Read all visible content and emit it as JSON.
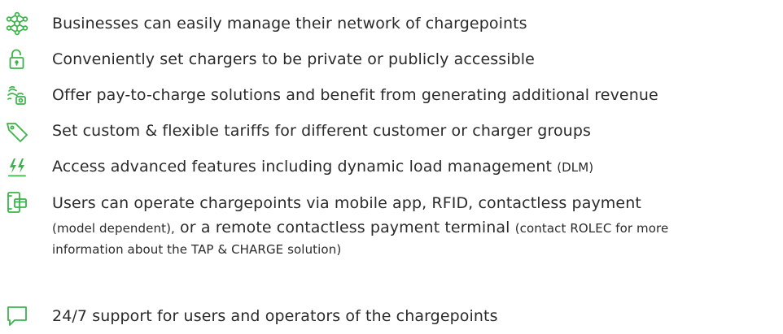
{
  "accent_color": "#3bb54a",
  "items": [
    {
      "icon": "network-icon",
      "text": "Businesses can easily manage their network of chargepoints"
    },
    {
      "icon": "unlock-padlock-icon",
      "text": "Conveniently set chargers to be private or publicly accessible"
    },
    {
      "icon": "pay-to-charge-icon",
      "text": "Offer pay-to-charge solutions and benefit from generating additional revenue"
    },
    {
      "icon": "price-tag-icon",
      "text": "Set custom & flexible tariffs for different customer or charger groups"
    },
    {
      "icon": "dynamic-load-bolts-icon",
      "text_main": "Access advanced features including dynamic load management",
      "text_suffix": "(DLM)"
    },
    {
      "icon": "mobile-app-icon",
      "line1": "Users can operate chargepoints via mobile app, RFID, contactless payment",
      "line2_small_a": "(model dependent),",
      "line2_big": " or a remote contactless payment terminal ",
      "line2_small_b": "(contact ROLEC for more",
      "line3_small": "information about the TAP & CHARGE solution)"
    },
    {
      "icon": "chat-bubble-icon",
      "text": "24/7 support for users and operators of the chargepoints"
    }
  ]
}
